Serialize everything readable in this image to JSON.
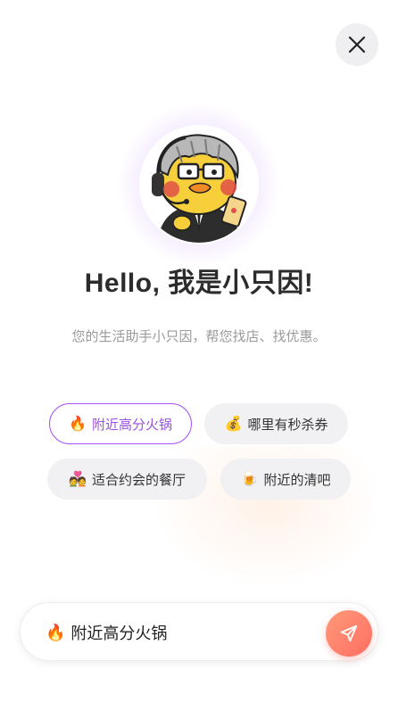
{
  "header": {
    "close_icon": "close-icon"
  },
  "greeting": {
    "title": "Hello, 我是小只因!",
    "subtitle": "您的生活助手小只因，帮您找店、找优惠。"
  },
  "suggestions": [
    {
      "icon": "🔥",
      "label": "附近高分火锅",
      "active": true
    },
    {
      "icon": "💰",
      "label": "哪里有秒杀券",
      "active": false
    },
    {
      "icon": "💑",
      "label": "适合约会的餐厅",
      "active": false
    },
    {
      "icon": "🍺",
      "label": "附近的清吧",
      "active": false
    }
  ],
  "composer": {
    "icon": "🔥",
    "value": "附近高分火锅",
    "send_icon": "send-icon"
  },
  "colors": {
    "accent": "#a855f7",
    "send_gradient_start": "#ff9a7a",
    "send_gradient_end": "#ff6e61"
  }
}
